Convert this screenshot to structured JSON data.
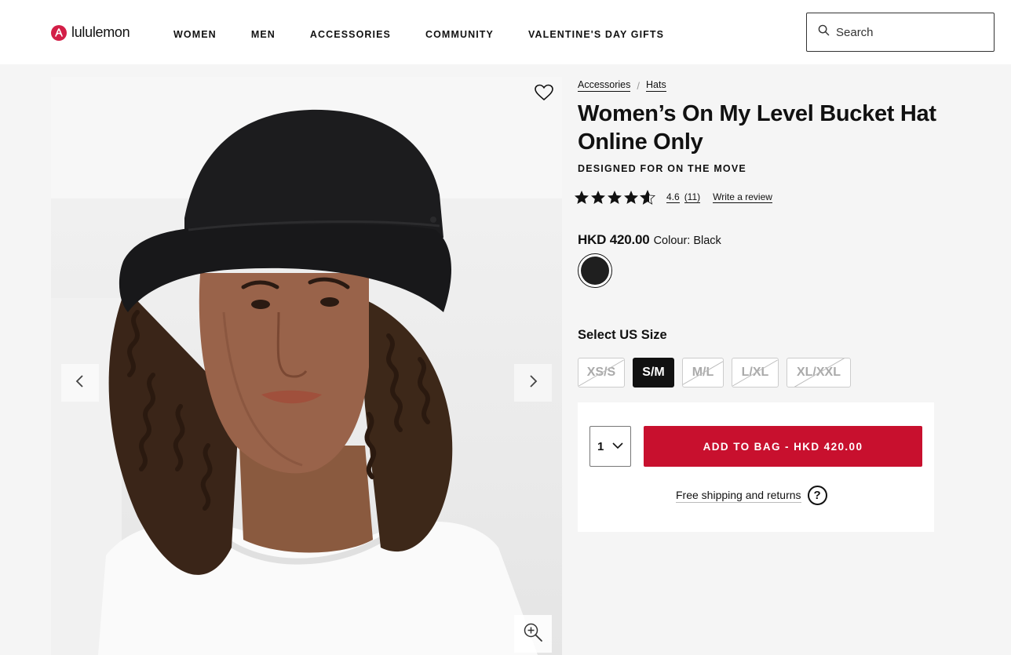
{
  "header": {
    "logo_text": "lululemon",
    "nav": [
      "WOMEN",
      "MEN",
      "ACCESSORIES",
      "COMMUNITY",
      "VALENTINE'S DAY GIFTS"
    ],
    "search_placeholder": "Search"
  },
  "breadcrumb": [
    "Accessories",
    "Hats"
  ],
  "breadcrumb_separator": "/",
  "product": {
    "title": "Women’s On My Level Bucket Hat Online Only",
    "tagline": "DESIGNED FOR ON THE MOVE",
    "rating": "4.6",
    "rating_stars": 4.6,
    "review_count": "(11)",
    "write_review": "Write a review",
    "price": "HKD 420.00",
    "colour_label": "Colour: Black",
    "swatch_color": "#1f1f1f"
  },
  "size": {
    "heading": "Select US Size",
    "options": [
      {
        "label": "XS/S",
        "state": "unavailable"
      },
      {
        "label": "S/M",
        "state": "selected"
      },
      {
        "label": "M/L",
        "state": "unavailable"
      },
      {
        "label": "L/XL",
        "state": "unavailable"
      },
      {
        "label": "XL/XXL",
        "state": "unavailable"
      }
    ]
  },
  "purchase": {
    "quantity": "1",
    "add_to_bag": "ADD TO BAG - HKD 420.00",
    "shipping_link": "Free shipping and returns",
    "help_icon": "?"
  },
  "colors": {
    "brand_red": "#c8102e",
    "logo_red": "#d31e47"
  },
  "icons": [
    "lululemon-logo-icon",
    "search-icon",
    "heart-icon",
    "chevron-left-icon",
    "chevron-right-icon",
    "zoom-in-icon",
    "chevron-down-icon",
    "question-icon",
    "star-icon"
  ]
}
